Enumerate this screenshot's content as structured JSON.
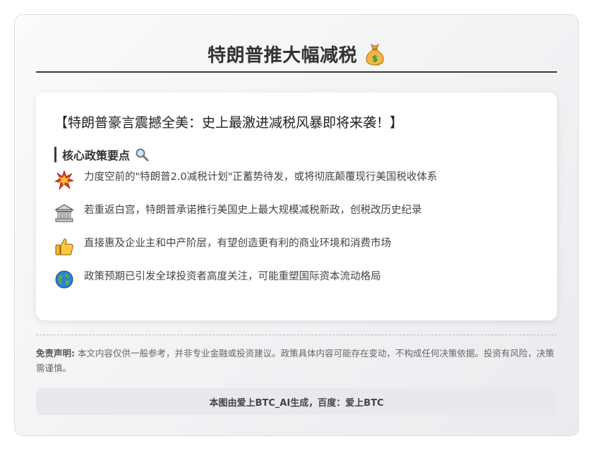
{
  "header": {
    "title": "特朗普推大幅减税",
    "title_icon": "money-bag-icon"
  },
  "content": {
    "headline": "【特朗普豪言震撼全美：史上最激进减税风暴即将来袭！】",
    "section_title": "核心政策要点",
    "section_icon": "magnifier-icon",
    "points": [
      {
        "icon": "collision-icon",
        "text": "力度空前的\"特朗普2.0减税计划\"正蓄势待发，或将彻底颠覆现行美国税收体系"
      },
      {
        "icon": "classical-building-icon",
        "text": "若重返白宫，特朗普承诺推行美国史上最大规模减税新政，创税改历史纪录"
      },
      {
        "icon": "thumbs-up-icon",
        "text": "直接惠及企业主和中产阶层，有望创造更有利的商业环境和消费市场"
      },
      {
        "icon": "globe-icon",
        "text": "政策预期已引发全球投资者高度关注，可能重塑国际资本流动格局"
      }
    ]
  },
  "disclaimer": {
    "label": "免责声明:",
    "text": "本文内容仅供一般参考，并非专业金融或投资建议。政策具体内容可能存在变动，不构成任何决策依据。投资有风险，决策需谨慎。"
  },
  "footer": {
    "text": "本图由爱上BTC_AI生成，百度：爱上BTC"
  }
}
